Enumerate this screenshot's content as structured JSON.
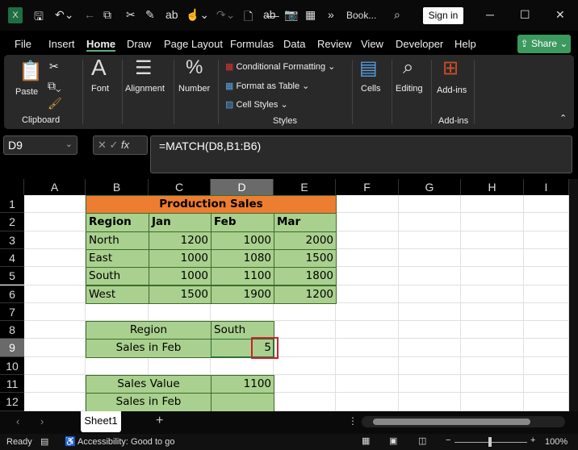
{
  "titlebar": {
    "filename": "Book...",
    "sign_in": "Sign in",
    "app_icon": "excel-icon",
    "minimize": "─",
    "maximize": "☐",
    "close": "✕"
  },
  "tabs": [
    "File",
    "Insert",
    "Home",
    "Draw",
    "Page Layout",
    "Formulas",
    "Data",
    "Review",
    "View",
    "Developer",
    "Help"
  ],
  "share": "Share",
  "ribbon": {
    "paste": "Paste",
    "clipboard": "Clipboard",
    "font": "Font",
    "alignment": "Alignment",
    "number": "Number",
    "cond_fmt": "Conditional Formatting",
    "fmt_table": "Format as Table",
    "cell_styles": "Cell Styles",
    "styles": "Styles",
    "cells": "Cells",
    "editing": "Editing",
    "addins": "Add-ins",
    "addins_group": "Add-ins"
  },
  "formula_bar": {
    "name_box": "D9",
    "fx": "fx",
    "formula": "=MATCH(D8,B1:B6)"
  },
  "grid": {
    "columns": [
      "A",
      "B",
      "C",
      "D",
      "E",
      "F",
      "G",
      "H",
      "I"
    ],
    "rows": [
      "1",
      "2",
      "3",
      "4",
      "5",
      "6",
      "7",
      "8",
      "9",
      "10",
      "11",
      "12"
    ],
    "selected": "D9",
    "colors": {
      "orange": "#ED7D31",
      "green": "#A9D08E",
      "selection_box": "#D0202A"
    },
    "cells": [
      {
        "ref": "B1:E1",
        "text": "Production Sales",
        "align": "center",
        "bold": true,
        "fill": "#ED7D31"
      },
      {
        "ref": "B2",
        "text": "Region",
        "bold": true,
        "fill": "#A9D08E"
      },
      {
        "ref": "C2",
        "text": "Jan",
        "bold": true,
        "fill": "#A9D08E"
      },
      {
        "ref": "D2",
        "text": "Feb",
        "bold": true,
        "fill": "#A9D08E"
      },
      {
        "ref": "E2",
        "text": "Mar",
        "bold": true,
        "fill": "#A9D08E"
      },
      {
        "ref": "B3",
        "text": "North",
        "fill": "#A9D08E"
      },
      {
        "ref": "C3",
        "text": "1200",
        "align": "right",
        "fill": "#A9D08E"
      },
      {
        "ref": "D3",
        "text": "1000",
        "align": "right",
        "fill": "#A9D08E"
      },
      {
        "ref": "E3",
        "text": "2000",
        "align": "right",
        "fill": "#A9D08E"
      },
      {
        "ref": "B4",
        "text": "East",
        "fill": "#A9D08E"
      },
      {
        "ref": "C4",
        "text": "1000",
        "align": "right",
        "fill": "#A9D08E"
      },
      {
        "ref": "D4",
        "text": "1080",
        "align": "right",
        "fill": "#A9D08E"
      },
      {
        "ref": "E4",
        "text": "1500",
        "align": "right",
        "fill": "#A9D08E"
      },
      {
        "ref": "B5",
        "text": "South",
        "fill": "#A9D08E"
      },
      {
        "ref": "C5",
        "text": "1000",
        "align": "right",
        "fill": "#A9D08E"
      },
      {
        "ref": "D5",
        "text": "1100",
        "align": "right",
        "fill": "#A9D08E"
      },
      {
        "ref": "E5",
        "text": "1800",
        "align": "right",
        "fill": "#A9D08E"
      },
      {
        "ref": "B6",
        "text": "West",
        "fill": "#A9D08E"
      },
      {
        "ref": "C6",
        "text": "1500",
        "align": "right",
        "fill": "#A9D08E"
      },
      {
        "ref": "D6",
        "text": "1900",
        "align": "right",
        "fill": "#A9D08E"
      },
      {
        "ref": "E6",
        "text": "1200",
        "align": "right",
        "fill": "#A9D08E"
      },
      {
        "ref": "B8:C8",
        "text": "Region",
        "align": "center",
        "fill": "#A9D08E"
      },
      {
        "ref": "D8",
        "text": "South",
        "fill": "#A9D08E"
      },
      {
        "ref": "B9:C9",
        "text": "Sales in Feb",
        "align": "center",
        "fill": "#A9D08E"
      },
      {
        "ref": "D9",
        "text": "5",
        "align": "right",
        "fill": "#A9D08E"
      },
      {
        "ref": "B11:C11",
        "text": "Sales Value",
        "align": "center",
        "fill": "#A9D08E"
      },
      {
        "ref": "D11",
        "text": "1100",
        "align": "right",
        "fill": "#A9D08E"
      },
      {
        "ref": "B12:C12",
        "text": "Sales in Feb",
        "align": "center",
        "fill": "#A9D08E"
      },
      {
        "ref": "D12",
        "text": "",
        "fill": "#A9D08E"
      }
    ]
  },
  "sheets": {
    "active": "Sheet1",
    "add": "+"
  },
  "status": {
    "ready": "Ready",
    "accessibility": "Accessibility: Good to go",
    "zoom": "100%"
  }
}
